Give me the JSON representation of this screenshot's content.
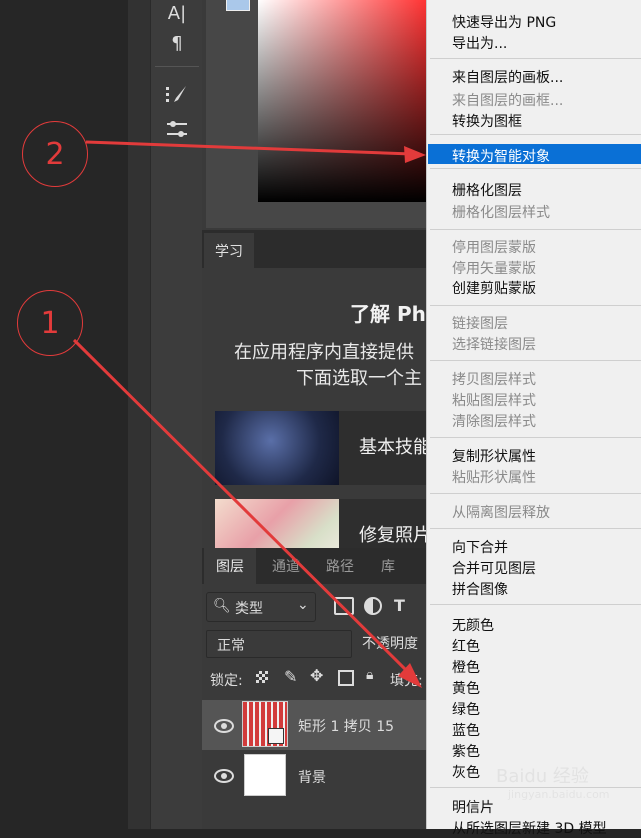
{
  "menu": {
    "items": [
      {
        "label": "快速导出为 PNG",
        "disabled": false
      },
      {
        "label": "导出为...",
        "disabled": false
      },
      {
        "label": "来自图层的画板...",
        "disabled": false
      },
      {
        "label": "来自图层的画框...",
        "disabled": true
      },
      {
        "label": "转换为图框",
        "disabled": false
      },
      {
        "label": "转换为智能对象",
        "disabled": false,
        "highlighted": true
      },
      {
        "label": "栅格化图层",
        "disabled": false
      },
      {
        "label": "栅格化图层样式",
        "disabled": true
      },
      {
        "label": "停用图层蒙版",
        "disabled": true
      },
      {
        "label": "停用矢量蒙版",
        "disabled": true
      },
      {
        "label": "创建剪贴蒙版",
        "disabled": false
      },
      {
        "label": "链接图层",
        "disabled": true
      },
      {
        "label": "选择链接图层",
        "disabled": true
      },
      {
        "label": "拷贝图层样式",
        "disabled": true
      },
      {
        "label": "粘贴图层样式",
        "disabled": true
      },
      {
        "label": "清除图层样式",
        "disabled": true
      },
      {
        "label": "复制形状属性",
        "disabled": false
      },
      {
        "label": "粘贴形状属性",
        "disabled": true
      },
      {
        "label": "从隔离图层释放",
        "disabled": true
      },
      {
        "label": "向下合并",
        "disabled": false
      },
      {
        "label": "合并可见图层",
        "disabled": false
      },
      {
        "label": "拼合图像",
        "disabled": false
      },
      {
        "label": "无颜色",
        "disabled": false
      },
      {
        "label": "红色",
        "disabled": false
      },
      {
        "label": "橙色",
        "disabled": false
      },
      {
        "label": "黄色",
        "disabled": false
      },
      {
        "label": "绿色",
        "disabled": false
      },
      {
        "label": "蓝色",
        "disabled": false
      },
      {
        "label": "紫色",
        "disabled": false
      },
      {
        "label": "灰色",
        "disabled": false
      },
      {
        "label": "明信片",
        "disabled": false
      },
      {
        "label": "从所选图层新建 3D 模型",
        "disabled": false
      }
    ]
  },
  "learn": {
    "tab": "学习",
    "title": "了解 Ph",
    "desc_line1": "在应用程序内直接提供",
    "desc_line2": "下面选取一个主",
    "cards": [
      {
        "label": "基本技能"
      },
      {
        "label": "修复照片"
      }
    ]
  },
  "layers": {
    "tabs": [
      "图层",
      "通道",
      "路径",
      "库"
    ],
    "filter_label": "类型",
    "blend_mode": "正常",
    "opacity_label": "不透明度",
    "lock_label": "锁定:",
    "fill_label": "填充:",
    "rows": [
      {
        "name": "矩形 1 拷贝 15"
      },
      {
        "name": "背景"
      }
    ]
  },
  "annotations": {
    "step1": "1",
    "step2": "2"
  },
  "watermark": {
    "text": "Baidu 经验",
    "sub": "jingyan.baidu.com"
  },
  "colors": {
    "highlight": "#0a70d6",
    "annotation": "#e23b3b"
  }
}
